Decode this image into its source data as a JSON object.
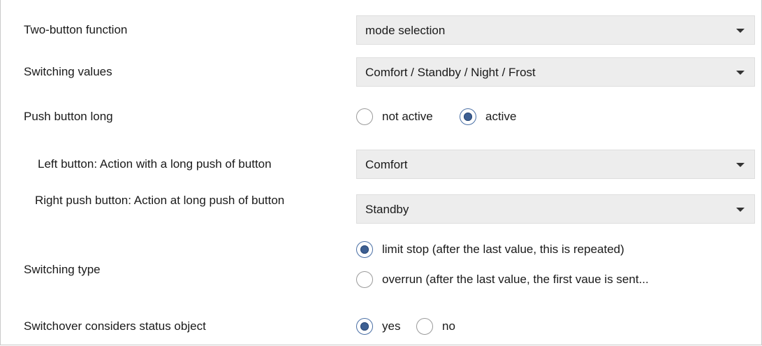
{
  "rows": {
    "two_button_function": {
      "label": "Two-button function",
      "value": "mode selection"
    },
    "switching_values": {
      "label": "Switching values",
      "value": "Comfort / Standby / Night / Frost"
    },
    "push_button_long": {
      "label": "Push button long",
      "options": [
        "not active",
        "active"
      ],
      "selected": "active"
    },
    "left_button_long": {
      "label": "Left button: Action with a long push of button",
      "value": "Comfort"
    },
    "right_button_long": {
      "label": "Right push button: Action at long push of button",
      "value": "Standby"
    },
    "switching_type": {
      "label": "Switching type",
      "options": [
        "limit stop (after the last value, this is repeated)",
        "overrun (after the last value, the first vaue is sent..."
      ],
      "selected": "limit stop (after the last value, this is repeated)"
    },
    "switchover_status": {
      "label": "Switchover considers status object",
      "options": [
        "yes",
        "no"
      ],
      "selected": "yes"
    }
  },
  "colors": {
    "dropdown_bg": "#ededed",
    "radio_accent": "#3d5f92"
  },
  "icons": {
    "dropdown_caret": "chevron-down-icon",
    "radio": "radio-button-icon"
  }
}
